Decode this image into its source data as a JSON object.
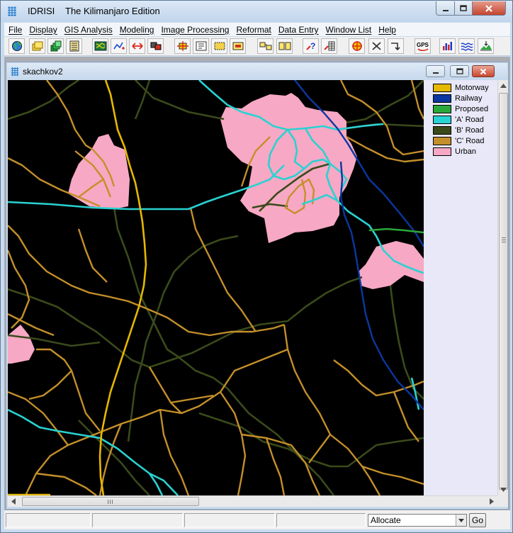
{
  "window": {
    "app_name": "IDRISI",
    "edition": "The Kilimanjaro Edition"
  },
  "menu": [
    "File",
    "Display",
    "GIS Analysis",
    "Modeling",
    "Image Processing",
    "Reformat",
    "Data Entry",
    "Window List",
    "Help"
  ],
  "toolbar": {
    "buttons": [
      "display-launcher",
      "open-file",
      "composer",
      "layer-properties",
      "map-window",
      "add-layer",
      "swap",
      "group",
      "move",
      "report",
      "select",
      "digitize",
      "arrange",
      "split",
      "query",
      "query-table",
      "target",
      "tools",
      "arrow",
      "gps",
      "histogram",
      "surface",
      "elevation"
    ],
    "gps_label": "GPS"
  },
  "map_window": {
    "title": "skachkov2"
  },
  "legend": [
    {
      "label": "Motorway",
      "color": "#e6b800"
    },
    {
      "label": "Railway",
      "color": "#0a37a0"
    },
    {
      "label": "Proposed",
      "color": "#2aa83a"
    },
    {
      "label": "'A' Road",
      "color": "#29d2d2"
    },
    {
      "label": "'B' Road",
      "color": "#3a4a1a"
    },
    {
      "label": "'C' Road",
      "color": "#c48f2a"
    },
    {
      "label": "Urban",
      "color": "#f7a8c4"
    }
  ],
  "statusbar": {
    "command": "Allocate",
    "go_label": "Go"
  }
}
